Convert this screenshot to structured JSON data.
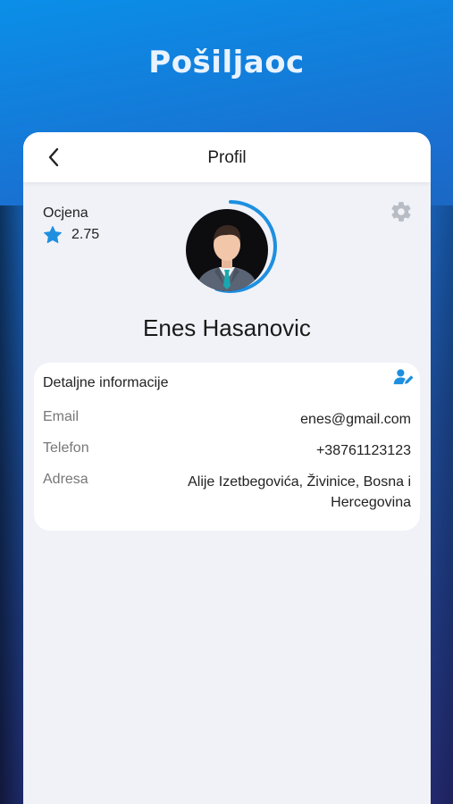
{
  "hero": {
    "title": "Pošiljaoc"
  },
  "appbar": {
    "title": "Profil",
    "back_icon": "chevron-left-icon"
  },
  "rating": {
    "label": "Ocjena",
    "value": "2.75",
    "icon": "star-icon",
    "progress": 0.55
  },
  "settings": {
    "icon": "gear-icon"
  },
  "user": {
    "name": "Enes Hasanovic",
    "avatar_icon": "businessman-avatar-icon"
  },
  "details": {
    "title": "Detaljne informacije",
    "edit_icon": "edit-user-icon",
    "rows": [
      {
        "label": "Email",
        "value": "enes@gmail.com"
      },
      {
        "label": "Telefon",
        "value": "+38761123123"
      },
      {
        "label": "Adresa",
        "value": "Alije Izetbegovića, Živinice, Bosna i Hercegovina"
      }
    ]
  },
  "colors": {
    "accent": "#1e8fe0",
    "gradient_top": "#0a8fe8",
    "gradient_bottom": "#272d7a",
    "card_bg": "#f0f2f8"
  }
}
